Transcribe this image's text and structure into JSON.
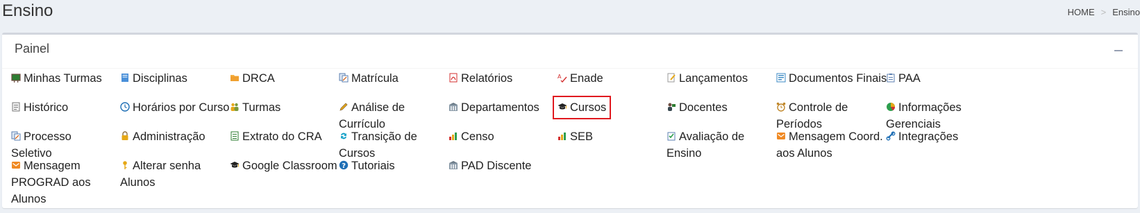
{
  "page": {
    "title": "Ensino"
  },
  "breadcrumb": {
    "home": "HOME",
    "separator": ">",
    "current": "Ensino"
  },
  "panel": {
    "title": "Painel",
    "collapse_label": "–"
  },
  "colors": {
    "highlight": "#e0191f"
  },
  "items": [
    {
      "label": "Minhas Turmas",
      "icon": "chalkboard-icon"
    },
    {
      "label": "Disciplinas",
      "icon": "book-icon"
    },
    {
      "label": "DRCA",
      "icon": "folder-icon"
    },
    {
      "label": "Matrícula",
      "icon": "documents-icon"
    },
    {
      "label": "Relatórios",
      "icon": "pdf-icon"
    },
    {
      "label": "Enade",
      "icon": "spell-check-icon"
    },
    {
      "label": "Lançamentos",
      "icon": "note-edit-icon"
    },
    {
      "label": "Documentos Finais",
      "icon": "form-icon"
    },
    {
      "label": "PAA",
      "icon": "clipboard-icon"
    },
    {
      "label": "Histórico",
      "icon": "report-icon"
    },
    {
      "label": "Horários por Curso",
      "icon": "clock-icon"
    },
    {
      "label": "Turmas",
      "icon": "group-icon"
    },
    {
      "label": "Análise de Currículo",
      "icon": "pencil-icon"
    },
    {
      "label": "Departamentos",
      "icon": "building-icon"
    },
    {
      "label": "Cursos",
      "icon": "graduation-cap-icon"
    },
    {
      "label": "Docentes",
      "icon": "teacher-icon"
    },
    {
      "label": "Controle de Períodos",
      "icon": "alarm-clock-icon"
    },
    {
      "label": "Informações Gerenciais",
      "icon": "pie-chart-icon"
    },
    {
      "label": "Processo Seletivo",
      "icon": "documents-icon"
    },
    {
      "label": "Administração",
      "icon": "lock-icon"
    },
    {
      "label": "Extrato do CRA",
      "icon": "spreadsheet-icon"
    },
    {
      "label": "Transição de Cursos",
      "icon": "refresh-icon"
    },
    {
      "label": "Censo",
      "icon": "bar-chart-icon"
    },
    {
      "label": "SEB",
      "icon": "bar-chart-icon"
    },
    {
      "label": "Avaliação de Ensino",
      "icon": "checklist-icon"
    },
    {
      "label": "Mensagem Coord. aos Alunos",
      "icon": "mail-icon"
    },
    {
      "label": "Integrações",
      "icon": "link-icon"
    },
    {
      "label": "Mensagem PROGRAD aos Alunos",
      "icon": "mail-icon"
    },
    {
      "label": "Alterar senha Alunos",
      "icon": "key-icon"
    },
    {
      "label": "Google Classroom",
      "icon": "graduation-cap-icon"
    },
    {
      "label": "Tutoriais",
      "icon": "help-icon"
    },
    {
      "label": "PAD Discente",
      "icon": "building-icon"
    }
  ]
}
